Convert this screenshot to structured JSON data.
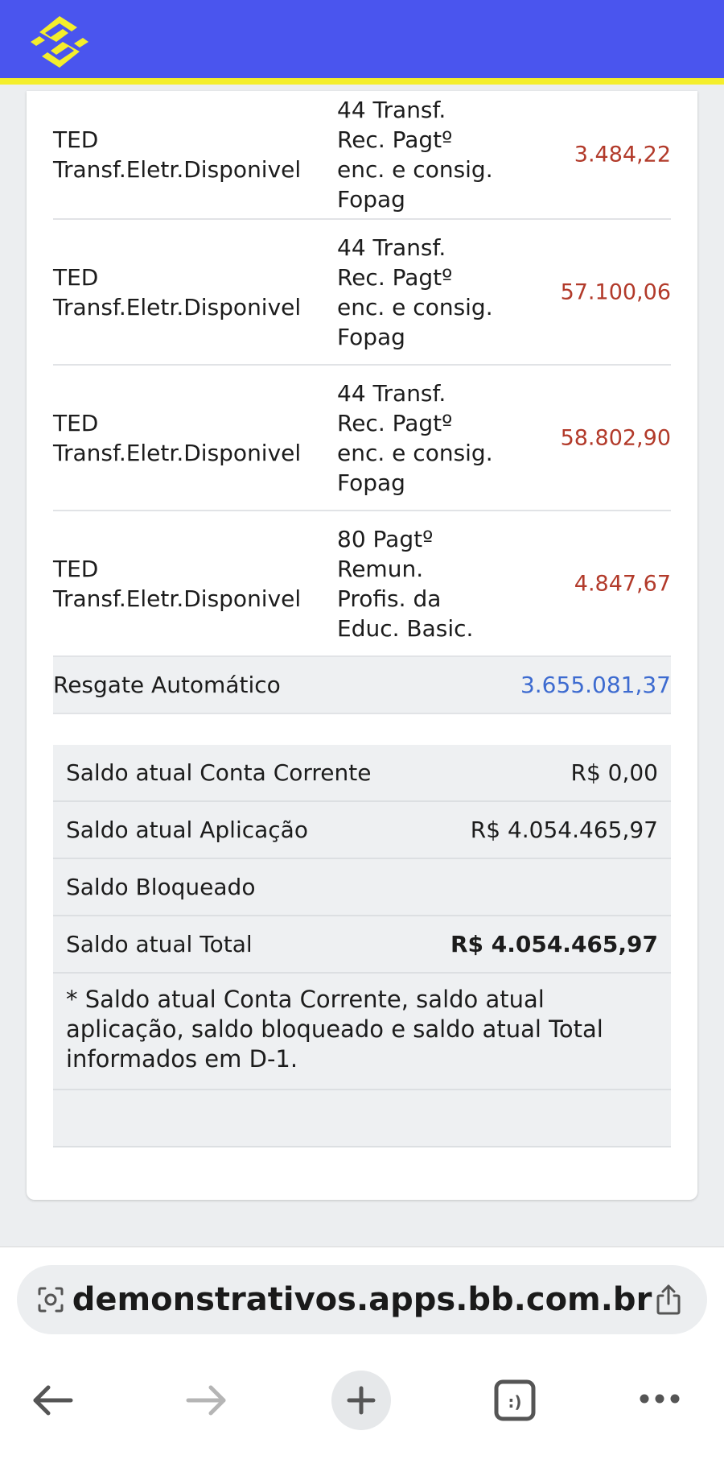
{
  "transactions": [
    {
      "desc_line1": "TED",
      "desc_line2": "Transf.Eletr.Disponivel",
      "detail": [
        "44 Transf.",
        "Rec. Pagtº",
        "enc. e consig.",
        "Fopag"
      ],
      "amount": "3.484,22"
    },
    {
      "desc_line1": "TED",
      "desc_line2": "Transf.Eletr.Disponivel",
      "detail": [
        "44 Transf.",
        "Rec. Pagtº",
        "enc. e consig.",
        "Fopag"
      ],
      "amount": "57.100,06"
    },
    {
      "desc_line1": "TED",
      "desc_line2": "Transf.Eletr.Disponivel",
      "detail": [
        "44 Transf.",
        "Rec. Pagtº",
        "enc. e consig.",
        "Fopag"
      ],
      "amount": "58.802,90"
    },
    {
      "desc_line1": "TED",
      "desc_line2": "Transf.Eletr.Disponivel",
      "detail": [
        "80 Pagtº",
        "Remun.",
        "Profis. da",
        "Educ. Basic."
      ],
      "amount": "4.847,67"
    }
  ],
  "resgate": {
    "label": "Resgate Automático",
    "amount": "3.655.081,37"
  },
  "summary": {
    "conta_corrente": {
      "label": "Saldo atual Conta Corrente",
      "value": "R$ 0,00"
    },
    "aplicacao": {
      "label": "Saldo atual Aplicação",
      "value": "R$ 4.054.465,97"
    },
    "bloqueado": {
      "label": "Saldo Bloqueado",
      "value": ""
    },
    "total": {
      "label": "Saldo atual Total",
      "value": "R$ 4.054.465,97"
    },
    "note": "* Saldo atual Conta Corrente, saldo atual aplicação, saldo bloqueado e saldo atual Total informados em D-1."
  },
  "browser": {
    "url": "demonstrativos.apps.bb.com.br"
  },
  "colors": {
    "header": "#4a55ee",
    "header_stripe": "#f4ee2c",
    "logo": "#f4ee2c",
    "debit": "#b23a2a",
    "credit": "#3d6bd0"
  },
  "icons": [
    "bb-logo-icon",
    "page-settings-icon",
    "share-icon",
    "back-arrow-icon",
    "forward-arrow-icon",
    "new-tab-plus-icon",
    "tabs-icon",
    "more-icon"
  ]
}
